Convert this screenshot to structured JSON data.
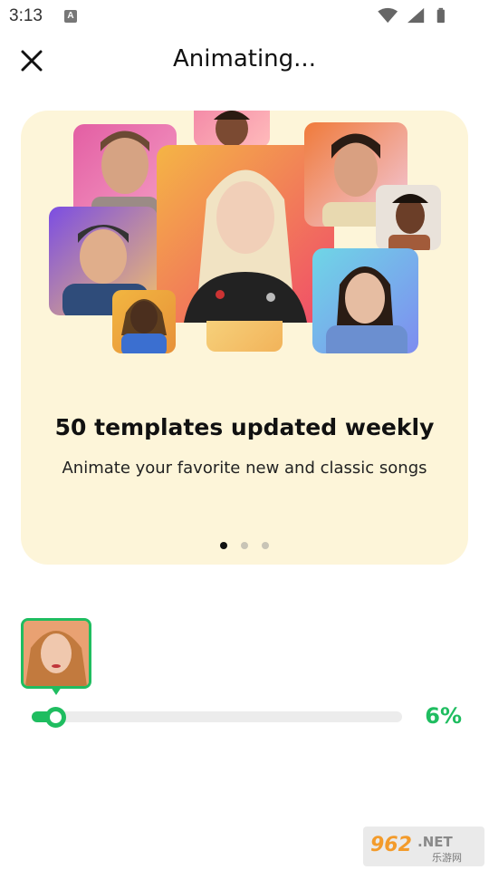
{
  "status_bar": {
    "time": "3:13",
    "notification_icon": "A",
    "icons": [
      "wifi-icon",
      "signal-icon",
      "battery-icon"
    ]
  },
  "header": {
    "title": "Animating...",
    "close_icon": "close-icon"
  },
  "card": {
    "background": "#fdf5d9",
    "title": "50 templates updated weekly",
    "subtitle": "Animate your favorite new and classic songs",
    "page_count": 3,
    "active_page": 1
  },
  "progress": {
    "percent_text": "6%",
    "value": 0.06,
    "accent_color": "#1fbd60"
  },
  "watermark": {
    "text": "962.NET",
    "subtext": "乐游网"
  }
}
